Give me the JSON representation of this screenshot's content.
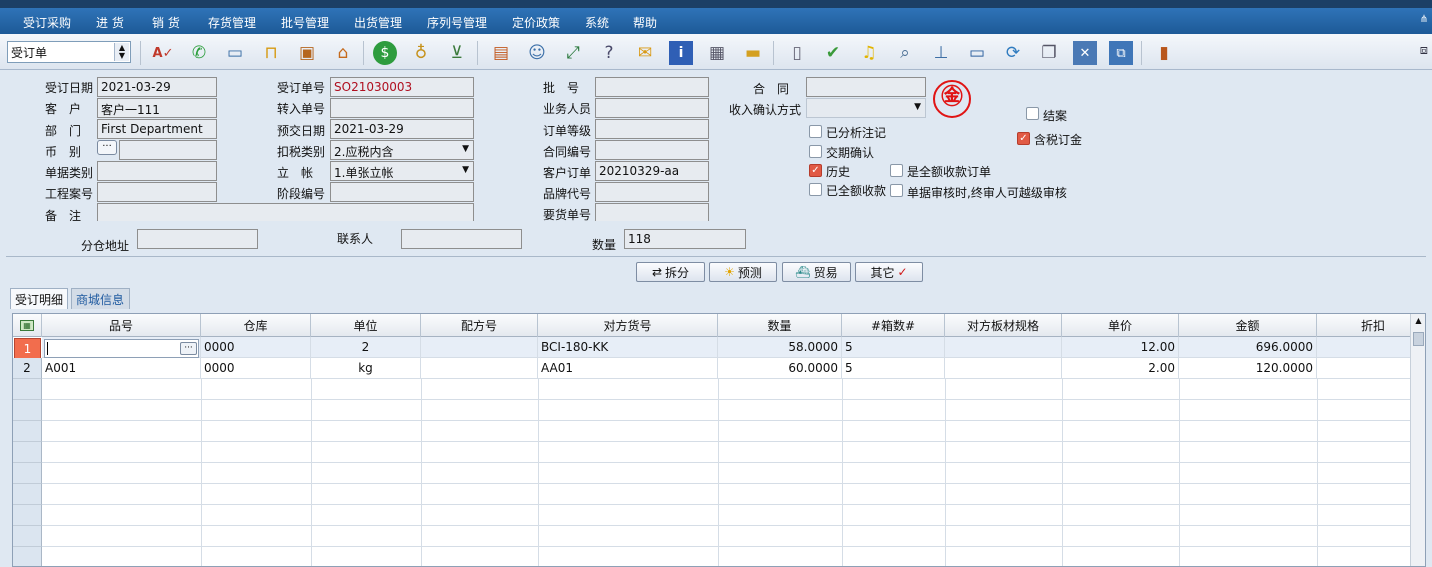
{
  "menu": [
    "受订采购",
    "进 货",
    "销 货",
    "存货管理",
    "批号管理",
    "出货管理",
    "序列号管理",
    "定价政策",
    "系统",
    "帮助"
  ],
  "toolbar": {
    "doc_type": "受订单",
    "icons": [
      "spell-check-icon",
      "phone-icon",
      "computer-icon",
      "lock-icon",
      "briefcase-icon",
      "home-icon",
      "dollar-icon",
      "money-bag-icon",
      "cart-icon",
      "clipboard-icon",
      "users-icon",
      "link-icon",
      "help-page-icon",
      "mail-icon",
      "info-icon",
      "calculator-icon",
      "folder-icon",
      "document-icon",
      "check-icon",
      "bell-icon",
      "search-icon",
      "tree-icon",
      "monitor-icon",
      "refresh-icon",
      "window-icon",
      "close-window-icon",
      "restore-icon",
      "exit-door-icon"
    ]
  },
  "form": {
    "order_date_label": "受订日期",
    "order_date": "2021-03-29",
    "customer_label": "客　户",
    "customer": "客户一111",
    "dept_label": "部　门",
    "dept": "First Department",
    "currency_label": "币　别",
    "currency": "",
    "doc_category_label": "单据类别",
    "doc_category": "",
    "project_no_label": "工程案号",
    "project_no": "",
    "remark_label": "备　注",
    "remark": "",
    "order_no_label": "受订单号",
    "order_no": "SO21030003",
    "transfer_no_label": "转入单号",
    "transfer_no": "",
    "delivery_date_label": "预交日期",
    "delivery_date": "2021-03-29",
    "tax_type_label": "扣税类别",
    "tax_type": "2.应税内含",
    "account_label": "立　帐",
    "account": "1.单张立帐",
    "stage_no_label": "阶段编号",
    "stage_no": "",
    "batch_label": "批　号",
    "batch": "",
    "sales_label": "业务人员",
    "sales": "",
    "level_label": "订单等级",
    "level": "",
    "contract_no_label": "合同编号",
    "contract_no": "",
    "cust_order_label": "客户订单",
    "cust_order": "20210329-aa",
    "brand_label": "品牌代号",
    "brand": "",
    "request_no_label": "要货单号",
    "request_no": "",
    "contract_label": "合　同",
    "contract": "",
    "income_confirm_label": "收入确认方式",
    "income_confirm": "",
    "branch_addr_label": "分仓地址",
    "branch_addr": "",
    "contact_label": "联系人",
    "contact": "",
    "qty_label": "数量",
    "qty": "118"
  },
  "checks": [
    {
      "label": "已分析注记",
      "checked": false
    },
    {
      "label": "交期确认",
      "checked": false
    },
    {
      "label": "历史",
      "checked": true
    },
    {
      "label": "已全额收款",
      "checked": false
    },
    {
      "label": "是全额收款订单",
      "checked": false
    },
    {
      "label": "单据审核时,终审人可越级审核",
      "checked": false
    },
    {
      "label": "结案",
      "checked": false
    },
    {
      "label": "含税订金",
      "checked": true
    }
  ],
  "actions": {
    "split": "拆分",
    "forecast": "预测",
    "trade": "贸易",
    "other": "其它"
  },
  "tabs": [
    "受订明细",
    "商城信息"
  ],
  "grid": {
    "headers": [
      "品号",
      "仓库",
      "单位",
      "配方号",
      "对方货号",
      "数量",
      "#箱数#",
      "对方板材规格",
      "单价",
      "金额",
      "折扣"
    ],
    "rows": [
      {
        "no": "1",
        "item": "",
        "wh": "0000",
        "unit": "2",
        "recipe": "",
        "cust_item": "BCI-180-KK",
        "qty": "58.0000",
        "boxes": "5",
        "spec": "",
        "price": "12.00",
        "amount": "696.0000",
        "disc": ""
      },
      {
        "no": "2",
        "item": "A001",
        "wh": "0000",
        "unit": "kg",
        "recipe": "",
        "cust_item": "AA01",
        "qty": "60.0000",
        "boxes": "5",
        "spec": "",
        "price": "2.00",
        "amount": "120.0000",
        "disc": ""
      }
    ]
  }
}
